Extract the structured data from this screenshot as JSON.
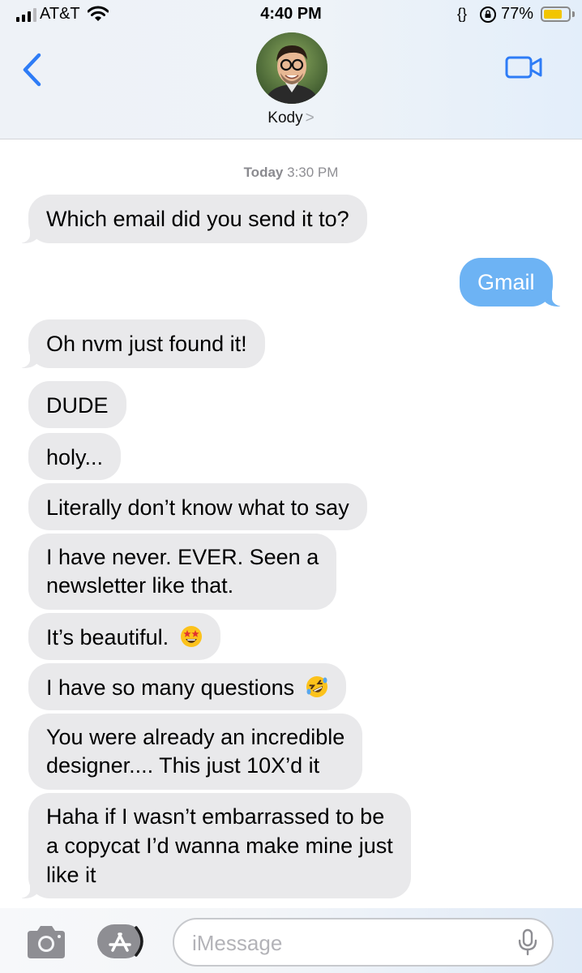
{
  "status_bar": {
    "carrier": "AT&T",
    "time": "4:40 PM",
    "rotation_lock": "{}",
    "battery_percent": "77%",
    "battery_level": 0.77,
    "battery_color": "#f2c500"
  },
  "header": {
    "contact_name": "Kody",
    "contact_chevron": ">",
    "icons": [
      "back-chevron-icon",
      "avatar",
      "video-camera-icon"
    ],
    "accent_color": "#2e7cf6"
  },
  "thread": {
    "timestamp_day": "Today",
    "timestamp_time": "3:30 PM",
    "messages": [
      {
        "direction": "received",
        "text": "Which email did you send it to?"
      },
      {
        "direction": "sent",
        "text": "Gmail"
      },
      {
        "direction": "received",
        "text": "Oh nvm just found it!"
      },
      {
        "direction": "received",
        "text": "DUDE"
      },
      {
        "direction": "received",
        "text": "holy..."
      },
      {
        "direction": "received",
        "text": "Literally don’t know what to say"
      },
      {
        "direction": "received",
        "lines": [
          "I have never. EVER. Seen a",
          "newsletter like that."
        ]
      },
      {
        "direction": "received",
        "text": "It’s beautiful.",
        "emoji": "star-struck-emoji"
      },
      {
        "direction": "received",
        "text": "I have so many questions",
        "emoji": "rolling-on-floor-laughing-emoji"
      },
      {
        "direction": "received",
        "lines": [
          "You were already an incredible",
          "designer.... This just 10X’d it"
        ]
      },
      {
        "direction": "received",
        "lines": [
          "Haha if I wasn’t embarrassed to be",
          "a copycat I’d wanna make mine just",
          "like it"
        ]
      }
    ],
    "received_bubble_color": "#e9e9eb",
    "sent_bubble_color": "#6db3f4"
  },
  "compose": {
    "placeholder": "iMessage",
    "icons": [
      "camera-icon",
      "app-store-icon",
      "microphone-icon"
    ]
  }
}
